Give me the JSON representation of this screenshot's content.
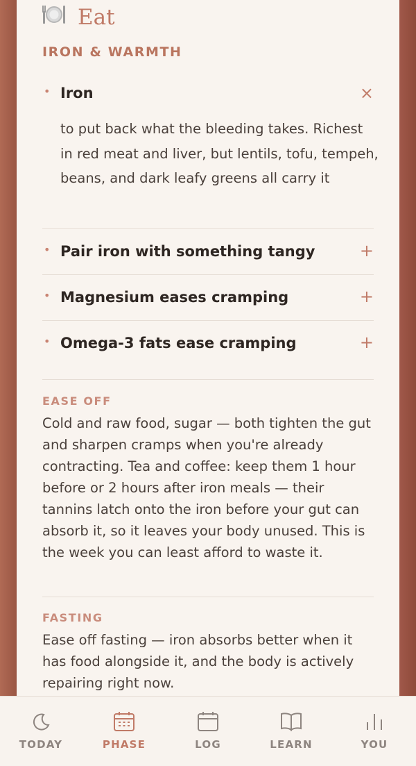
{
  "section": {
    "title": "Eat",
    "icon": "plate-cutlery-icon",
    "subheading": "IRON & WARMTH"
  },
  "accordion": [
    {
      "label": "Iron",
      "expanded": true,
      "control": "×",
      "body": "to put back what the bleeding takes. Richest in red meat and liver, but lentils, tofu, tempeh, beans, and dark leafy greens all carry it"
    },
    {
      "label": "Pair iron with something tangy",
      "expanded": false,
      "control": "+"
    },
    {
      "label": "Magnesium eases cramping",
      "expanded": false,
      "control": "+"
    },
    {
      "label": "Omega-3 fats ease cramping",
      "expanded": false,
      "control": "+"
    }
  ],
  "ease_off": {
    "label": "EASE OFF",
    "text": "Cold and raw food, sugar — both tighten the gut and sharpen cramps when you're already contracting. Tea and coffee: keep them 1 hour before or 2 hours after iron meals — their tannins latch onto the iron before your gut can absorb it, so it leaves your body unused. This is the week you can least afford to waste it."
  },
  "fasting": {
    "label": "FASTING",
    "text": "Ease off fasting — iron absorbs better when it has food alongside it, and the body is actively repairing right now."
  },
  "nav": {
    "active": "PHASE",
    "items": [
      {
        "label": "TODAY",
        "icon": "moon-icon"
      },
      {
        "label": "PHASE",
        "icon": "calendar-grid-icon"
      },
      {
        "label": "LOG",
        "icon": "calendar-icon"
      },
      {
        "label": "LEARN",
        "icon": "book-icon"
      },
      {
        "label": "YOU",
        "icon": "bar-chart-icon"
      }
    ]
  },
  "colors": {
    "accent": "#c07a67",
    "background": "#f9f4ef",
    "frame": "#a0584a",
    "text": "#2e2622",
    "muted": "#8e8580"
  }
}
